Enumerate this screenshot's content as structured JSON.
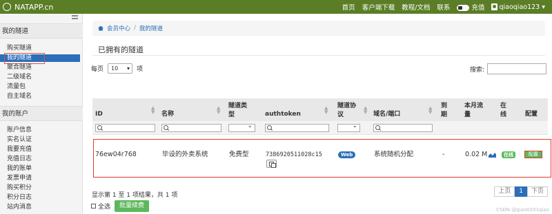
{
  "topbar": {
    "brand": "NATAPP.cn",
    "nav": [
      "首页",
      "客户端下载",
      "教程/文档",
      "联系"
    ],
    "recharge": "充值",
    "username": "qiaoqiao123 ▾"
  },
  "sidebar": {
    "section1": "我的隧道",
    "section1_items": [
      "购买隧道",
      "我的隧道",
      "聚合隧道",
      "二级域名",
      "流量包",
      "自主域名"
    ],
    "section2": "我的账户",
    "section2_items": [
      "账户信息",
      "实名认证",
      "我要充值",
      "充值日志",
      "我的账单",
      "发票申请",
      "购买积分",
      "积分日志",
      "站内消息"
    ]
  },
  "breadcrumb": [
    "会员中心",
    "/",
    "我的隧道"
  ],
  "page_title": "已拥有的隧道",
  "controls": {
    "per_page_prefix": "每页",
    "per_page_value": "10",
    "per_page_suffix": "项",
    "search_label": "搜索:"
  },
  "table": {
    "headers": {
      "id": "ID",
      "name": "名称",
      "type_l1": "隧道类",
      "type_l2": "型",
      "authtoken": "authtoken",
      "proto_l1": "隧道协",
      "proto_l2": "议",
      "domain": "域名/端口",
      "expire_l1": "到",
      "expire_l2": "期",
      "traffic_l1": "本月流",
      "traffic_l2": "量",
      "online_l1": "在",
      "online_l2": "线",
      "config": "配置"
    },
    "row": {
      "id": "76ew04r768",
      "name": "毕设的外卖系统",
      "type": "免费型",
      "authtoken": "7386920511028c15",
      "protocol": "Web",
      "domain": "系统随机分配",
      "expire": "-",
      "traffic": "0.02 M",
      "online": "在线",
      "config": "配置"
    }
  },
  "footer": {
    "summary": "显示第 1 至 1 项结果，共 1 项",
    "pager": [
      "上页",
      "1",
      "下页"
    ],
    "select_all": "全选",
    "batch_renew": "批量续费",
    "watermark": "CSDN @qiao0201qiao"
  },
  "colors": {
    "topbar": "#5a7d26",
    "accent_blue": "#2c6eb8",
    "success_green": "#5cb85c",
    "highlight_red": "#e0382a"
  }
}
